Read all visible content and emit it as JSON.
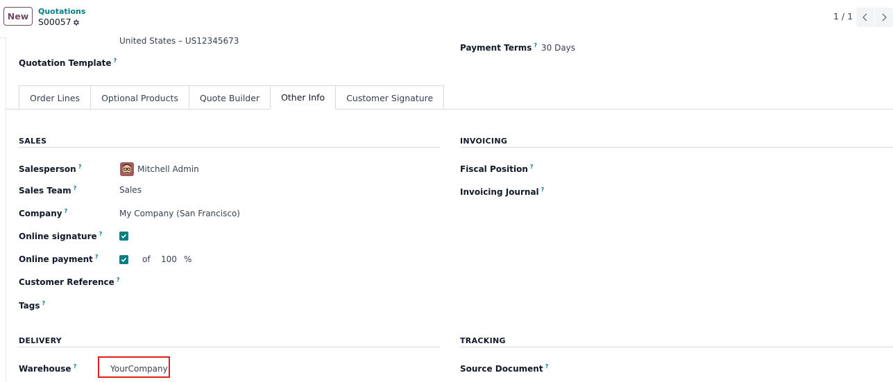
{
  "control_panel": {
    "new_label": "New",
    "breadcrumb_parent": "Quotations",
    "breadcrumb_current": "S00057",
    "pager": "1 / 1"
  },
  "header_fields": {
    "address_line": "United States – US12345673",
    "quotation_template_label": "Quotation Template",
    "payment_terms_label": "Payment Terms",
    "payment_terms_value": "30 Days"
  },
  "help_mark": "?",
  "tabs": [
    {
      "label": "Order Lines"
    },
    {
      "label": "Optional Products"
    },
    {
      "label": "Quote Builder"
    },
    {
      "label": "Other Info",
      "active": true
    },
    {
      "label": "Customer Signature"
    }
  ],
  "sales": {
    "title": "SALES",
    "salesperson_label": "Salesperson",
    "salesperson_value": "Mitchell Admin",
    "sales_team_label": "Sales Team",
    "sales_team_value": "Sales",
    "company_label": "Company",
    "company_value": "My Company (San Francisco)",
    "online_signature_label": "Online signature",
    "online_signature_checked": true,
    "online_payment_label": "Online payment",
    "online_payment_checked": true,
    "online_payment_of": "of",
    "online_payment_percent": "100",
    "online_payment_unit": "%",
    "customer_reference_label": "Customer Reference",
    "tags_label": "Tags"
  },
  "invoicing": {
    "title": "INVOICING",
    "fiscal_position_label": "Fiscal Position",
    "invoicing_journal_label": "Invoicing Journal"
  },
  "delivery": {
    "title": "DELIVERY",
    "warehouse_label": "Warehouse",
    "warehouse_value": "YourCompany"
  },
  "tracking": {
    "title": "TRACKING",
    "source_document_label": "Source Document"
  },
  "colors": {
    "brand": "#714B67",
    "accent": "#017e84",
    "highlight_border": "#e11d1d"
  }
}
